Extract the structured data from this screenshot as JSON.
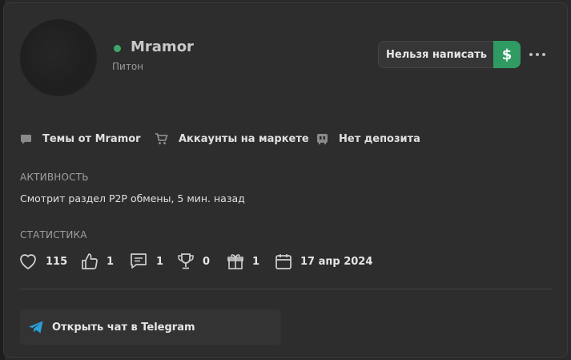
{
  "profile": {
    "username": "Mramor",
    "role": "Питон",
    "online": true
  },
  "actions": {
    "write_label": "Нельзя написать",
    "money_symbol": "$",
    "more_icon": "more-dots-icon"
  },
  "links": [
    {
      "label": "Темы от Mramor",
      "icon": "comment-icon"
    },
    {
      "label": "Аккаунты на маркете",
      "icon": "cart-icon"
    },
    {
      "label": "Нет депозита",
      "icon": "deposit-icon"
    }
  ],
  "activity": {
    "title": "АКТИВНОСТЬ",
    "text": "Смотрит раздел P2P обмены, 5 мин. назад"
  },
  "stats": {
    "title": "СТАТИСТИКА",
    "likes": "115",
    "thumbs": "1",
    "messages": "1",
    "trophies": "0",
    "gifts": "1",
    "registered": "17 апр 2024"
  },
  "telegram": {
    "label": "Открыть чат в Telegram"
  },
  "colors": {
    "accent_green": "#2f9b63",
    "online_dot": "#3fa56b",
    "telegram_blue": "#2a9fd8"
  }
}
